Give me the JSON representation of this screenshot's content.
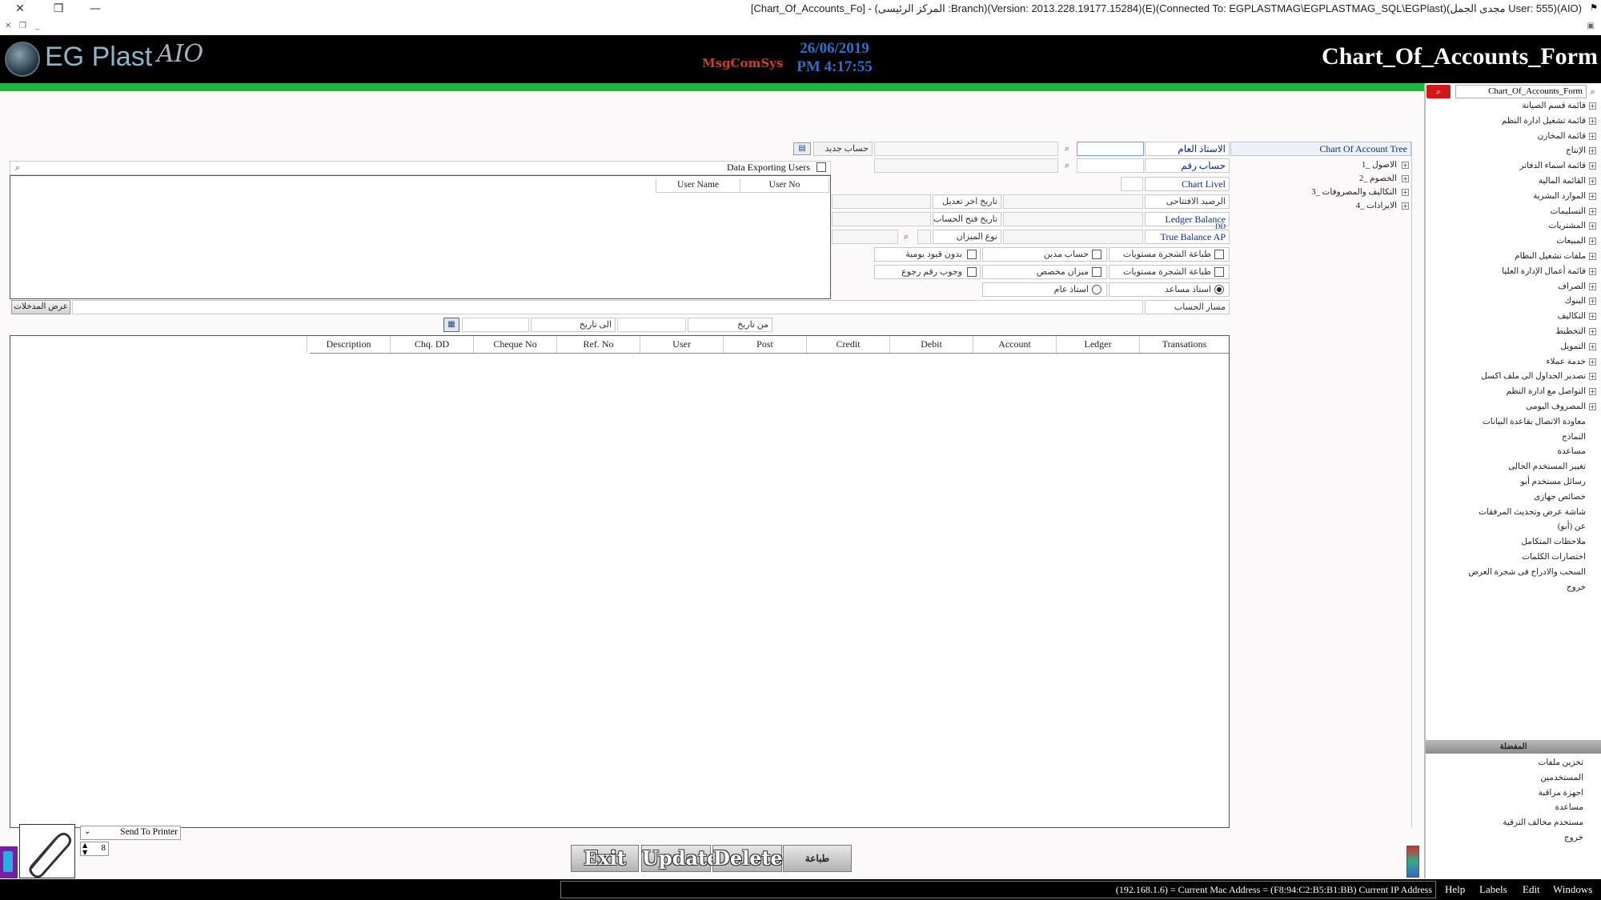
{
  "window": {
    "title": "[Chart_Of_Accounts_Fo] - (المركز الرئيسى :Branch)(Version: 2013.228.19177.15284)(E)(Connected To: EGPLASTMAG\\EGPLASTMAG_SQL\\EGPlast)(مجدى الجمل User: 555)(AIO)"
  },
  "header": {
    "brand": "EG Plast",
    "brand_suffix": "AIO",
    "msg_logo": "MsgComSys",
    "date": "26/06/2019",
    "time": "PM 4:17:55",
    "form_title": "Chart_Of_Accounts_Form"
  },
  "sidebar": {
    "search_value": "Chart_Of_Accounts_Form",
    "items": [
      {
        "label": "قائمة قسم الصيانة",
        "expandable": true
      },
      {
        "label": "قائمة تشغيل ادارة النظم",
        "expandable": true
      },
      {
        "label": "قائمة المخازن",
        "expandable": true
      },
      {
        "label": "الإنتاج",
        "expandable": true
      },
      {
        "label": "قائمة اسماء الدفاتر",
        "expandable": true
      },
      {
        "label": "القائمة المالية",
        "expandable": true
      },
      {
        "label": "الموارد البشرية",
        "expandable": true
      },
      {
        "label": "التسليمات",
        "expandable": true
      },
      {
        "label": "المشتريات",
        "expandable": true
      },
      {
        "label": "المبيعات",
        "expandable": true
      },
      {
        "label": "ملفات تشغيل النظام",
        "expandable": true
      },
      {
        "label": "قائمة أعمال الإدارة العليا",
        "expandable": true
      },
      {
        "label": "الصراف",
        "expandable": true
      },
      {
        "label": "البنوك",
        "expandable": true
      },
      {
        "label": "التكاليف",
        "expandable": true
      },
      {
        "label": "التخطيط",
        "expandable": true
      },
      {
        "label": "التمويل",
        "expandable": true
      },
      {
        "label": "خدمة عملاء",
        "expandable": true
      },
      {
        "label": "تصدير الجداول الى ملف اكسل",
        "expandable": true
      },
      {
        "label": "التواصل مع ادارة النظم",
        "expandable": true
      },
      {
        "label": "المصروف اليومى",
        "expandable": true
      },
      {
        "label": "معاودة الاتصال بقاعدة البيانات",
        "expandable": false
      },
      {
        "label": "النماذج",
        "expandable": false
      },
      {
        "label": "مساعدة",
        "expandable": false
      },
      {
        "label": "تغيير المستخدم الحالى",
        "expandable": false
      },
      {
        "label": "رسائل مستخدم أبو",
        "expandable": false
      },
      {
        "label": "خصائص جهازى",
        "expandable": false
      },
      {
        "label": "شاشة عرض وتحديث المرفقات",
        "expandable": false
      },
      {
        "label": "عن (أبو)",
        "expandable": false
      },
      {
        "label": "ملاحظات المتكامل",
        "expandable": false
      },
      {
        "label": "اختصارات الكلمات",
        "expandable": false
      },
      {
        "label": "السحب والادراج فى شجرة العرض",
        "expandable": false
      },
      {
        "label": "خروج",
        "expandable": false
      }
    ],
    "favorites_title": "المفضلة",
    "favorites": [
      "تخزين ملفات",
      "المستخدمين",
      "اجهزة مراقبة",
      "مساعدة",
      "مستخدم مخالف الترقية",
      "خروج"
    ]
  },
  "tree": {
    "title": "Chart Of Account Tree",
    "nodes": [
      "1_ الاصول",
      "2_ الخصوم",
      "3_ التكاليف والمصروفات",
      "4_ الايرادات"
    ]
  },
  "form": {
    "general_ledger": "الاستاذ العام",
    "account_no": "حساب رقم",
    "chart_level": "Chart Livel",
    "opening_balance": "الرصيد الافتتاحى",
    "ledger_balance": "Ledger Balance",
    "ledger_balance_sub": "DD",
    "true_balance": "True Balance AP",
    "new_account": "حساب جديد",
    "last_modified": "تاريخ اخر تعديل",
    "opened_date": "تاريخ فتح الحساب",
    "balance_type": "نوع الميزان",
    "print_tree_1": "طباعة الشجرة مستويات",
    "print_tree_2": "طباعة الشجرة مستويات",
    "debit_account": "حساب مدين",
    "custom_balance": "ميزان مخصص",
    "no_daily_entries": "بدون قيود يومية",
    "return_required": "وجوب رقم رجوع",
    "sub_ledger": "استاذ مساعد",
    "general_ledger_radio": "استاذ عام",
    "account_path": "مسار الحساب",
    "show_entries": "عرض المدخلات",
    "from_date": "من تاريخ",
    "to_date": "الى تاريخ"
  },
  "users": {
    "export_label": "Data Exporting Users",
    "columns": [
      "User No",
      "User Name"
    ]
  },
  "transactions": {
    "columns": [
      "Transations",
      "Ledger",
      "Account",
      "Debit",
      "Credit",
      "Post",
      "User",
      "Ref. No",
      "Cheque No",
      "Chq. DD",
      "Description"
    ]
  },
  "bottom": {
    "send_to_printer": "Send To Printer",
    "copies": "8",
    "exit": "Exit",
    "update": "Update",
    "delete": "Delete",
    "print": "طباعة"
  },
  "status": {
    "ip_text": "(192.168.1.6) = Current Mac Address = (F8:94:C2:B5:B1:BB) Current IP Address",
    "menu": [
      "Help",
      "Labels",
      "Edit",
      "Windows"
    ]
  }
}
